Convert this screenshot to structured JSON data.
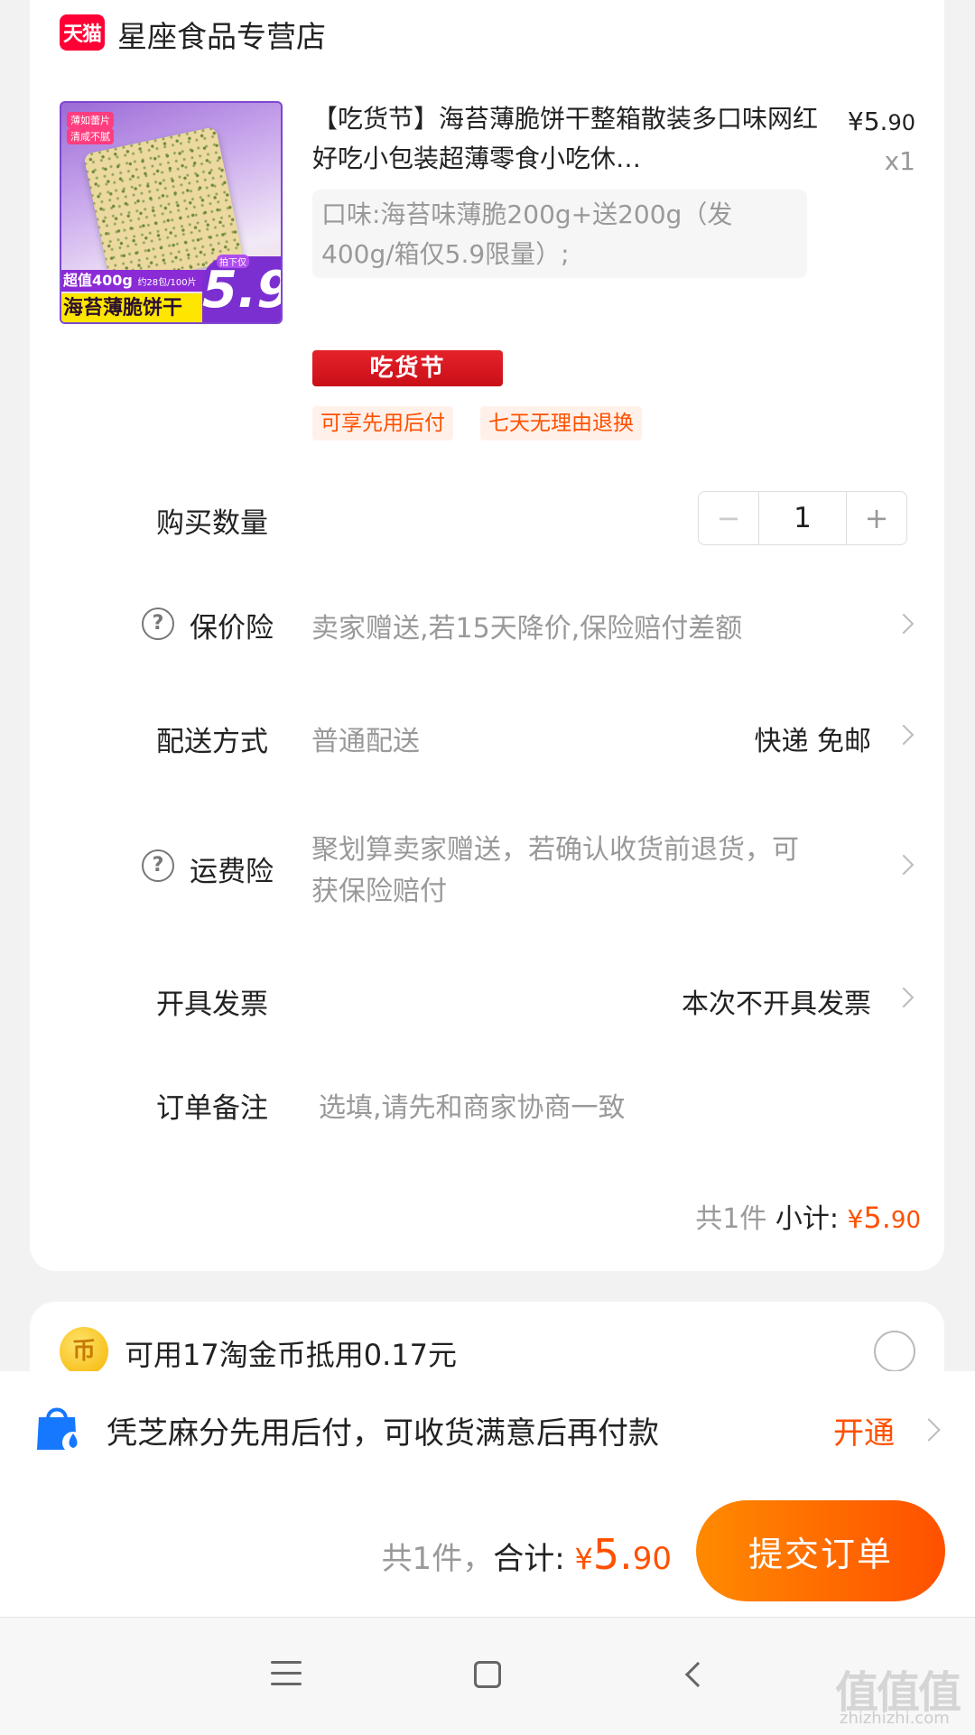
{
  "store": {
    "logo_text": "天猫",
    "name": "星座食品专营店"
  },
  "product": {
    "title": "【吃货节】海苔薄脆饼干整箱散装多口味网红好吃小包装超薄零食小吃休…",
    "price_yen": "¥",
    "price_int": "5.",
    "price_dec": "90",
    "quantity_label": "x1",
    "spec": "口味:海苔味薄脆200g+送200g（发400g/箱仅5.9限量）;",
    "image": {
      "tag1": "薄如蕾片",
      "tag2": "清咸不腻",
      "band1": "超值400g",
      "band1_small": "约28包/100片",
      "band2": "海苔薄脆饼干",
      "price_pre": "拍下仅",
      "price": "5.9"
    },
    "promo_badge": "吃货节",
    "tags": [
      "可享先用后付",
      "七天无理由退换"
    ]
  },
  "rows": {
    "quantity": {
      "label": "购买数量",
      "value": "1",
      "minus": "−",
      "plus": "+"
    },
    "price_protection": {
      "label": "保价险",
      "value": "卖家赠送,若15天降价,保险赔付差额",
      "help": "?"
    },
    "delivery": {
      "label": "配送方式",
      "value": "普通配送",
      "right": "快递 免邮"
    },
    "shipping_insurance": {
      "label": "运费险",
      "value_line1": "聚划算卖家赠送，若确认收货前退货，可",
      "value_line2": "获保险赔付",
      "help": "?"
    },
    "invoice": {
      "label": "开具发票",
      "right": "本次不开具发票"
    },
    "remark": {
      "label": "订单备注",
      "placeholder": "选填,请先和商家协商一致"
    }
  },
  "subtotal": {
    "count": "共1件",
    "label": "小计:",
    "yen": "¥",
    "int": "5.",
    "dec": "90"
  },
  "coins": {
    "icon_text": "币",
    "text": "可用17淘金币抵用0.17元"
  },
  "pay_later": {
    "text": "凭芝麻分先用后付，可收货满意后再付款",
    "action": "开通"
  },
  "total": {
    "count": "共1件，",
    "label": "合计:",
    "yen": "¥",
    "int": "5.",
    "dec": "90"
  },
  "submit_label": "提交订单",
  "watermark": {
    "main": "值值值",
    "sub": "zhizhizhi.com"
  },
  "colors": {
    "accent": "#ff5000",
    "tmall_red": "#ff0036"
  }
}
